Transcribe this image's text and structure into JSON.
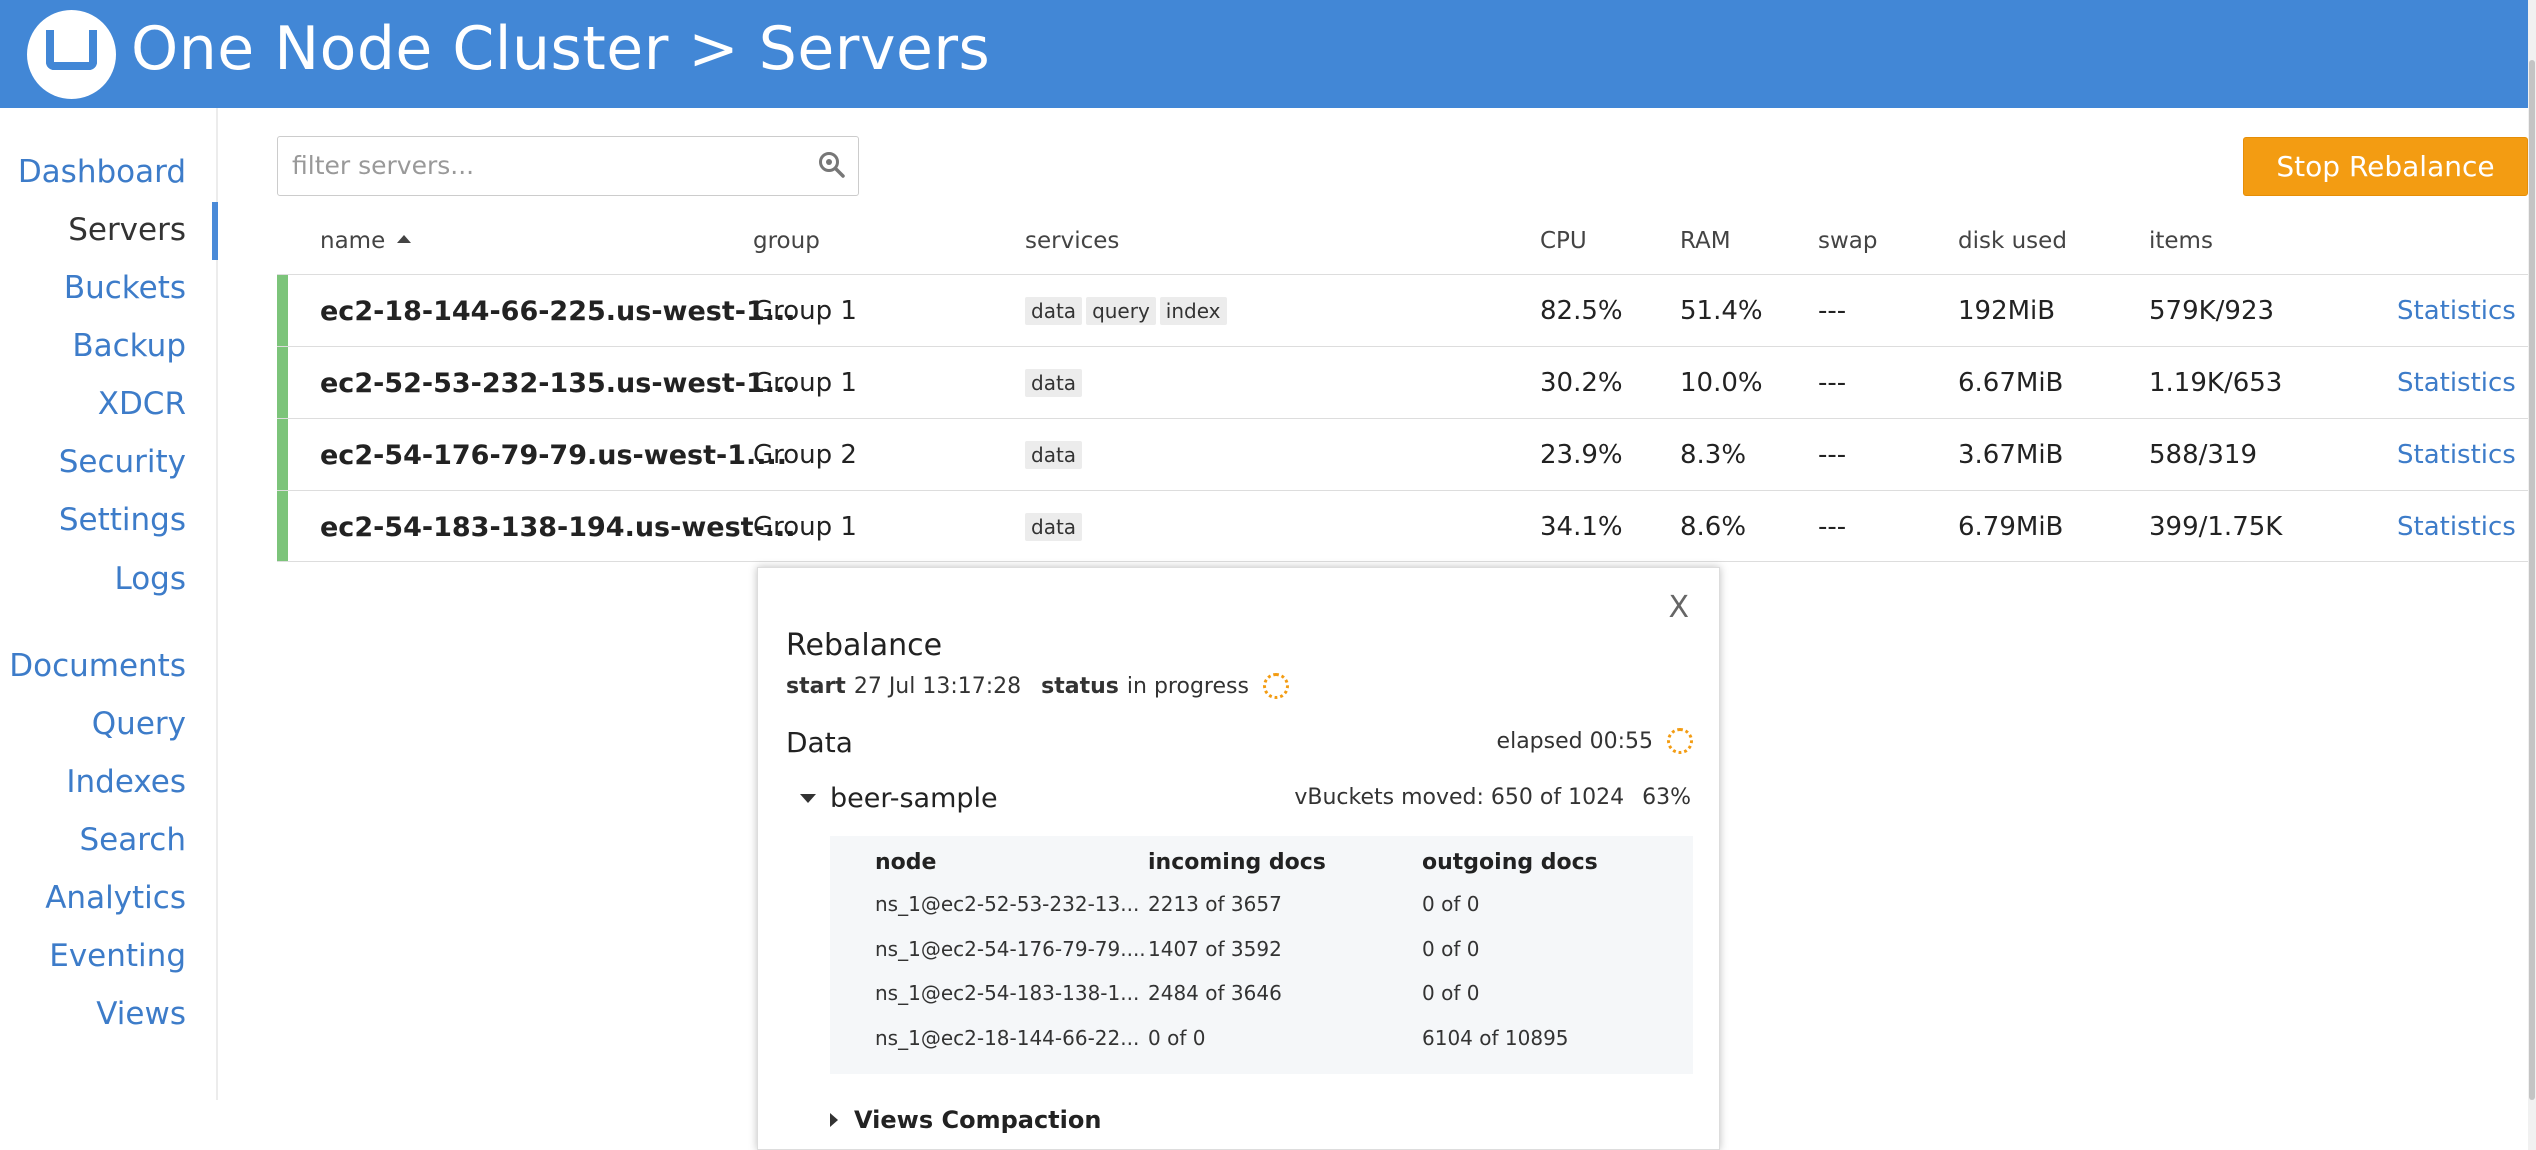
{
  "header": {
    "title": "One Node Cluster > Servers",
    "brand_color": "#4287d6"
  },
  "sidebar": {
    "items": [
      {
        "label": "Dashboard"
      },
      {
        "label": "Servers"
      },
      {
        "label": "Buckets"
      },
      {
        "label": "Backup"
      },
      {
        "label": "XDCR"
      },
      {
        "label": "Security"
      },
      {
        "label": "Settings"
      },
      {
        "label": "Logs"
      },
      {
        "label": "Documents"
      },
      {
        "label": "Query"
      },
      {
        "label": "Indexes"
      },
      {
        "label": "Search"
      },
      {
        "label": "Analytics"
      },
      {
        "label": "Eventing"
      },
      {
        "label": "Views"
      }
    ],
    "active": "Servers"
  },
  "toolbar": {
    "filter_placeholder": "filter servers...",
    "stop_label": "Stop Rebalance",
    "stop_color": "#f39c12"
  },
  "table": {
    "headers": {
      "name": "name",
      "group": "group",
      "services": "services",
      "cpu": "CPU",
      "ram": "RAM",
      "swap": "swap",
      "disk": "disk used",
      "items": "items"
    },
    "rows": [
      {
        "name": "ec2-18-144-66-225.us-west-1...",
        "group": "Group 1",
        "services": [
          "data",
          "query",
          "index"
        ],
        "cpu": "82.5%",
        "ram": "51.4%",
        "swap": "---",
        "disk": "192MiB",
        "items": "579K/923",
        "link": "Statistics"
      },
      {
        "name": "ec2-52-53-232-135.us-west-1...",
        "group": "Group 1",
        "services": [
          "data"
        ],
        "cpu": "30.2%",
        "ram": "10.0%",
        "swap": "---",
        "disk": "6.67MiB",
        "items": "1.19K/653",
        "link": "Statistics"
      },
      {
        "name": "ec2-54-176-79-79.us-west-1....",
        "group": "Group 2",
        "services": [
          "data"
        ],
        "cpu": "23.9%",
        "ram": "8.3%",
        "swap": "---",
        "disk": "3.67MiB",
        "items": "588/319",
        "link": "Statistics"
      },
      {
        "name": "ec2-54-183-138-194.us-west-...",
        "group": "Group 1",
        "services": [
          "data"
        ],
        "cpu": "34.1%",
        "ram": "8.6%",
        "swap": "---",
        "disk": "6.79MiB",
        "items": "399/1.75K",
        "link": "Statistics"
      }
    ],
    "status_color": "#7cc47a"
  },
  "rebalance": {
    "close_label": "X",
    "title": "Rebalance",
    "start_label": "start",
    "start_value": "27 Jul 13:17:28",
    "status_label": "status",
    "status_value": "in progress",
    "data_heading": "Data",
    "elapsed": "elapsed 00:55",
    "bucket_name": "beer-sample",
    "vbuckets_moved": "vBuckets moved: 650 of 1024",
    "percent": "63%",
    "inner_headers": {
      "node": "node",
      "incoming": "incoming docs",
      "outgoing": "outgoing docs"
    },
    "inner_rows": [
      {
        "node": "ns_1@ec2-52-53-232-13...",
        "incoming": "2213 of 3657",
        "outgoing": "0 of 0"
      },
      {
        "node": "ns_1@ec2-54-176-79-79....",
        "incoming": "1407 of 3592",
        "outgoing": "0 of 0"
      },
      {
        "node": "ns_1@ec2-54-183-138-1...",
        "incoming": "2484 of 3646",
        "outgoing": "0 of 0"
      },
      {
        "node": "ns_1@ec2-18-144-66-22...",
        "incoming": "0 of 0",
        "outgoing": "6104 of 10895"
      }
    ],
    "views_compaction": "Views Compaction"
  }
}
